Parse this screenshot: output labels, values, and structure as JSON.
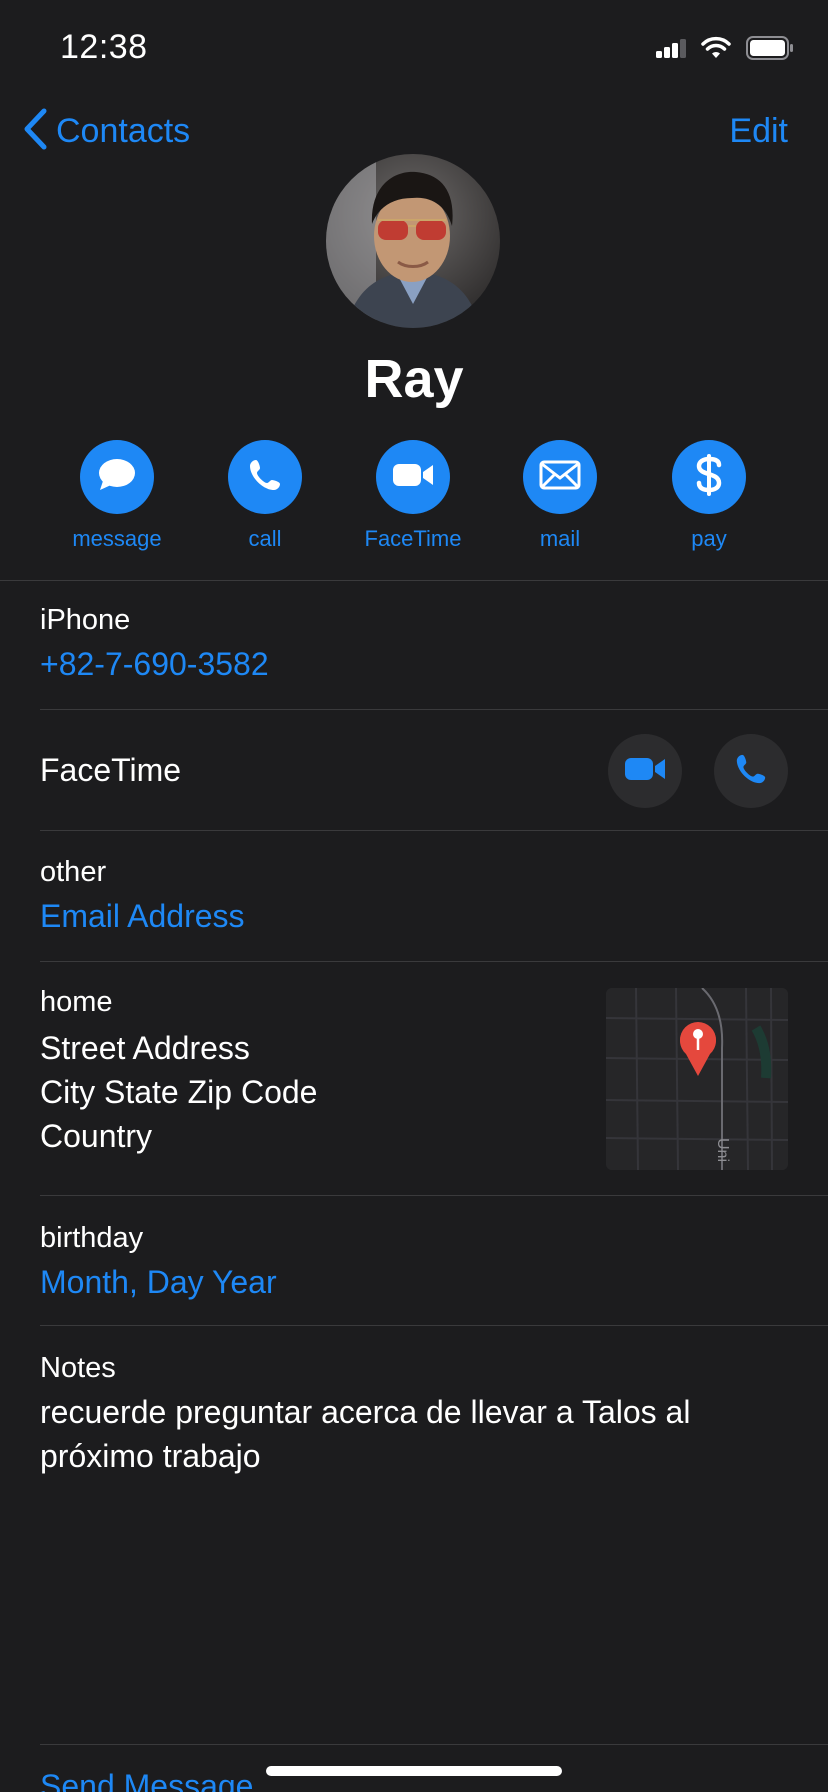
{
  "status_bar": {
    "time": "12:38"
  },
  "nav": {
    "back_label": "Contacts",
    "edit_label": "Edit"
  },
  "contact": {
    "name": "Ray"
  },
  "actions": [
    {
      "label": "message",
      "icon": "message-icon"
    },
    {
      "label": "call",
      "icon": "phone-icon"
    },
    {
      "label": "FaceTime",
      "icon": "video-icon"
    },
    {
      "label": "mail",
      "icon": "mail-icon"
    },
    {
      "label": "pay",
      "icon": "dollar-icon"
    }
  ],
  "phone": {
    "label": "iPhone",
    "value": "+82-7-690-3582"
  },
  "facetime": {
    "label": "FaceTime"
  },
  "email": {
    "label": "other",
    "value": "Email Address"
  },
  "address": {
    "label": "home",
    "street": "Street Address",
    "city": "City State Zip Code",
    "country": "Country",
    "map_text": "Uni"
  },
  "birthday": {
    "label": "birthday",
    "value": "Month, Day Year"
  },
  "notes": {
    "label": "Notes",
    "text": "recuerde preguntar acerca de llevar a Talos al próximo trabajo"
  },
  "footer": {
    "send_message": "Send Message"
  },
  "colors": {
    "accent": "#1e88f5",
    "background": "#1c1c1e",
    "separator": "#3a3a3c",
    "map_pin": "#e5483d"
  }
}
